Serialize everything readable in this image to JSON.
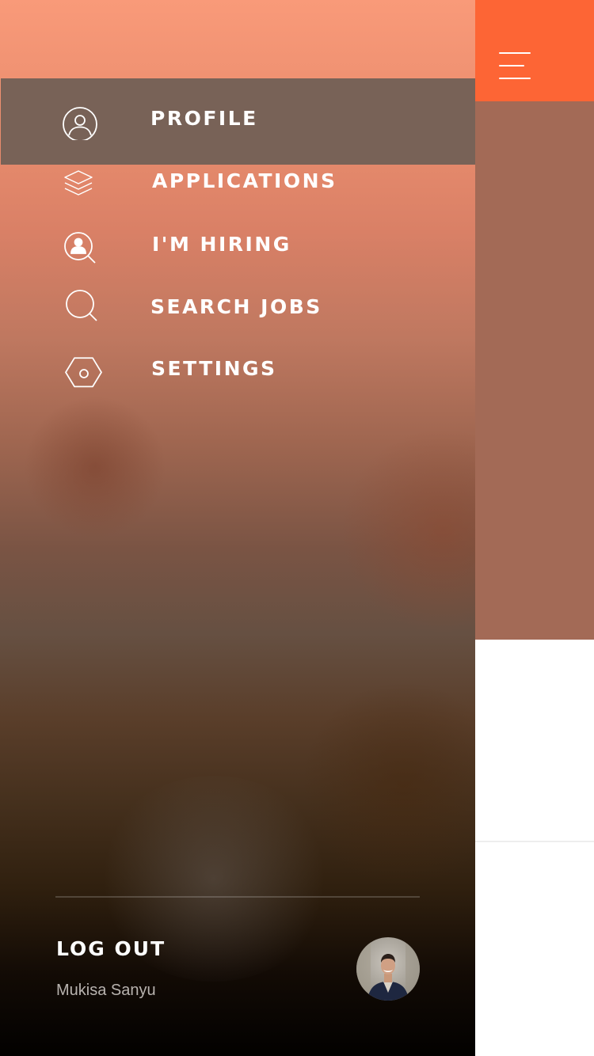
{
  "menu": {
    "items": [
      {
        "label": "PROFILE",
        "icon": "user-circle-icon",
        "active": true
      },
      {
        "label": "APPLICATIONS",
        "icon": "layers-icon",
        "active": false
      },
      {
        "label": "I'M HIRING",
        "icon": "user-search-icon",
        "active": false
      },
      {
        "label": "SEARCH JOBS",
        "icon": "search-icon",
        "active": false
      },
      {
        "label": "SETTINGS",
        "icon": "hexagon-settings-icon",
        "active": false
      }
    ]
  },
  "footer": {
    "logout_label": "LOG OUT",
    "user_name": "Mukisa Sanyu"
  },
  "colors": {
    "accent": "#fd6535",
    "active_item": "#786257",
    "text": "#ffffff",
    "muted_text": "#b8b3af"
  }
}
